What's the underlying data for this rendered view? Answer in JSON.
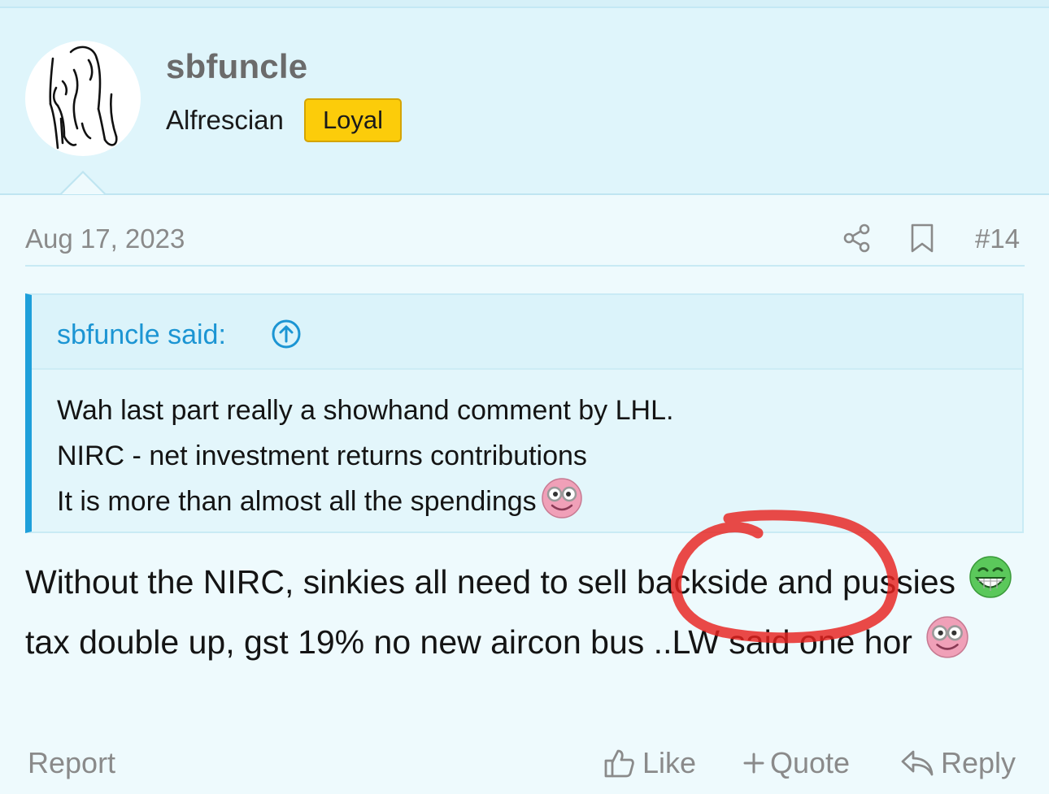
{
  "user": {
    "name": "sbfuncle",
    "title": "Alfrescian",
    "badge": "Loyal"
  },
  "post": {
    "date": "Aug 17, 2023",
    "number": "#14"
  },
  "quote": {
    "author": "sbfuncle said:",
    "lines": [
      "Wah last part really a showhand comment by LHL.",
      "NIRC - net investment returns contributions",
      "It is more than almost all the spendings"
    ]
  },
  "message": {
    "part1": "Without the NIRC, sinkies all need to sell backside and pussies",
    "part2": "tax double up, gst 19% no new aircon bus ..LW said one hor"
  },
  "actions": {
    "report": "Report",
    "like": "Like",
    "quote": "Quote",
    "reply": "Reply"
  },
  "icons": [
    "share-icon",
    "bookmark-icon",
    "arrow-up-circle-icon",
    "thumbs-up-icon",
    "plus-icon",
    "reply-arrow-icon",
    "nerd-emoji",
    "grin-emoji"
  ],
  "colors": {
    "accent": "#1e9fda",
    "badge": "#fccc0a",
    "annotation": "#e8221e"
  }
}
